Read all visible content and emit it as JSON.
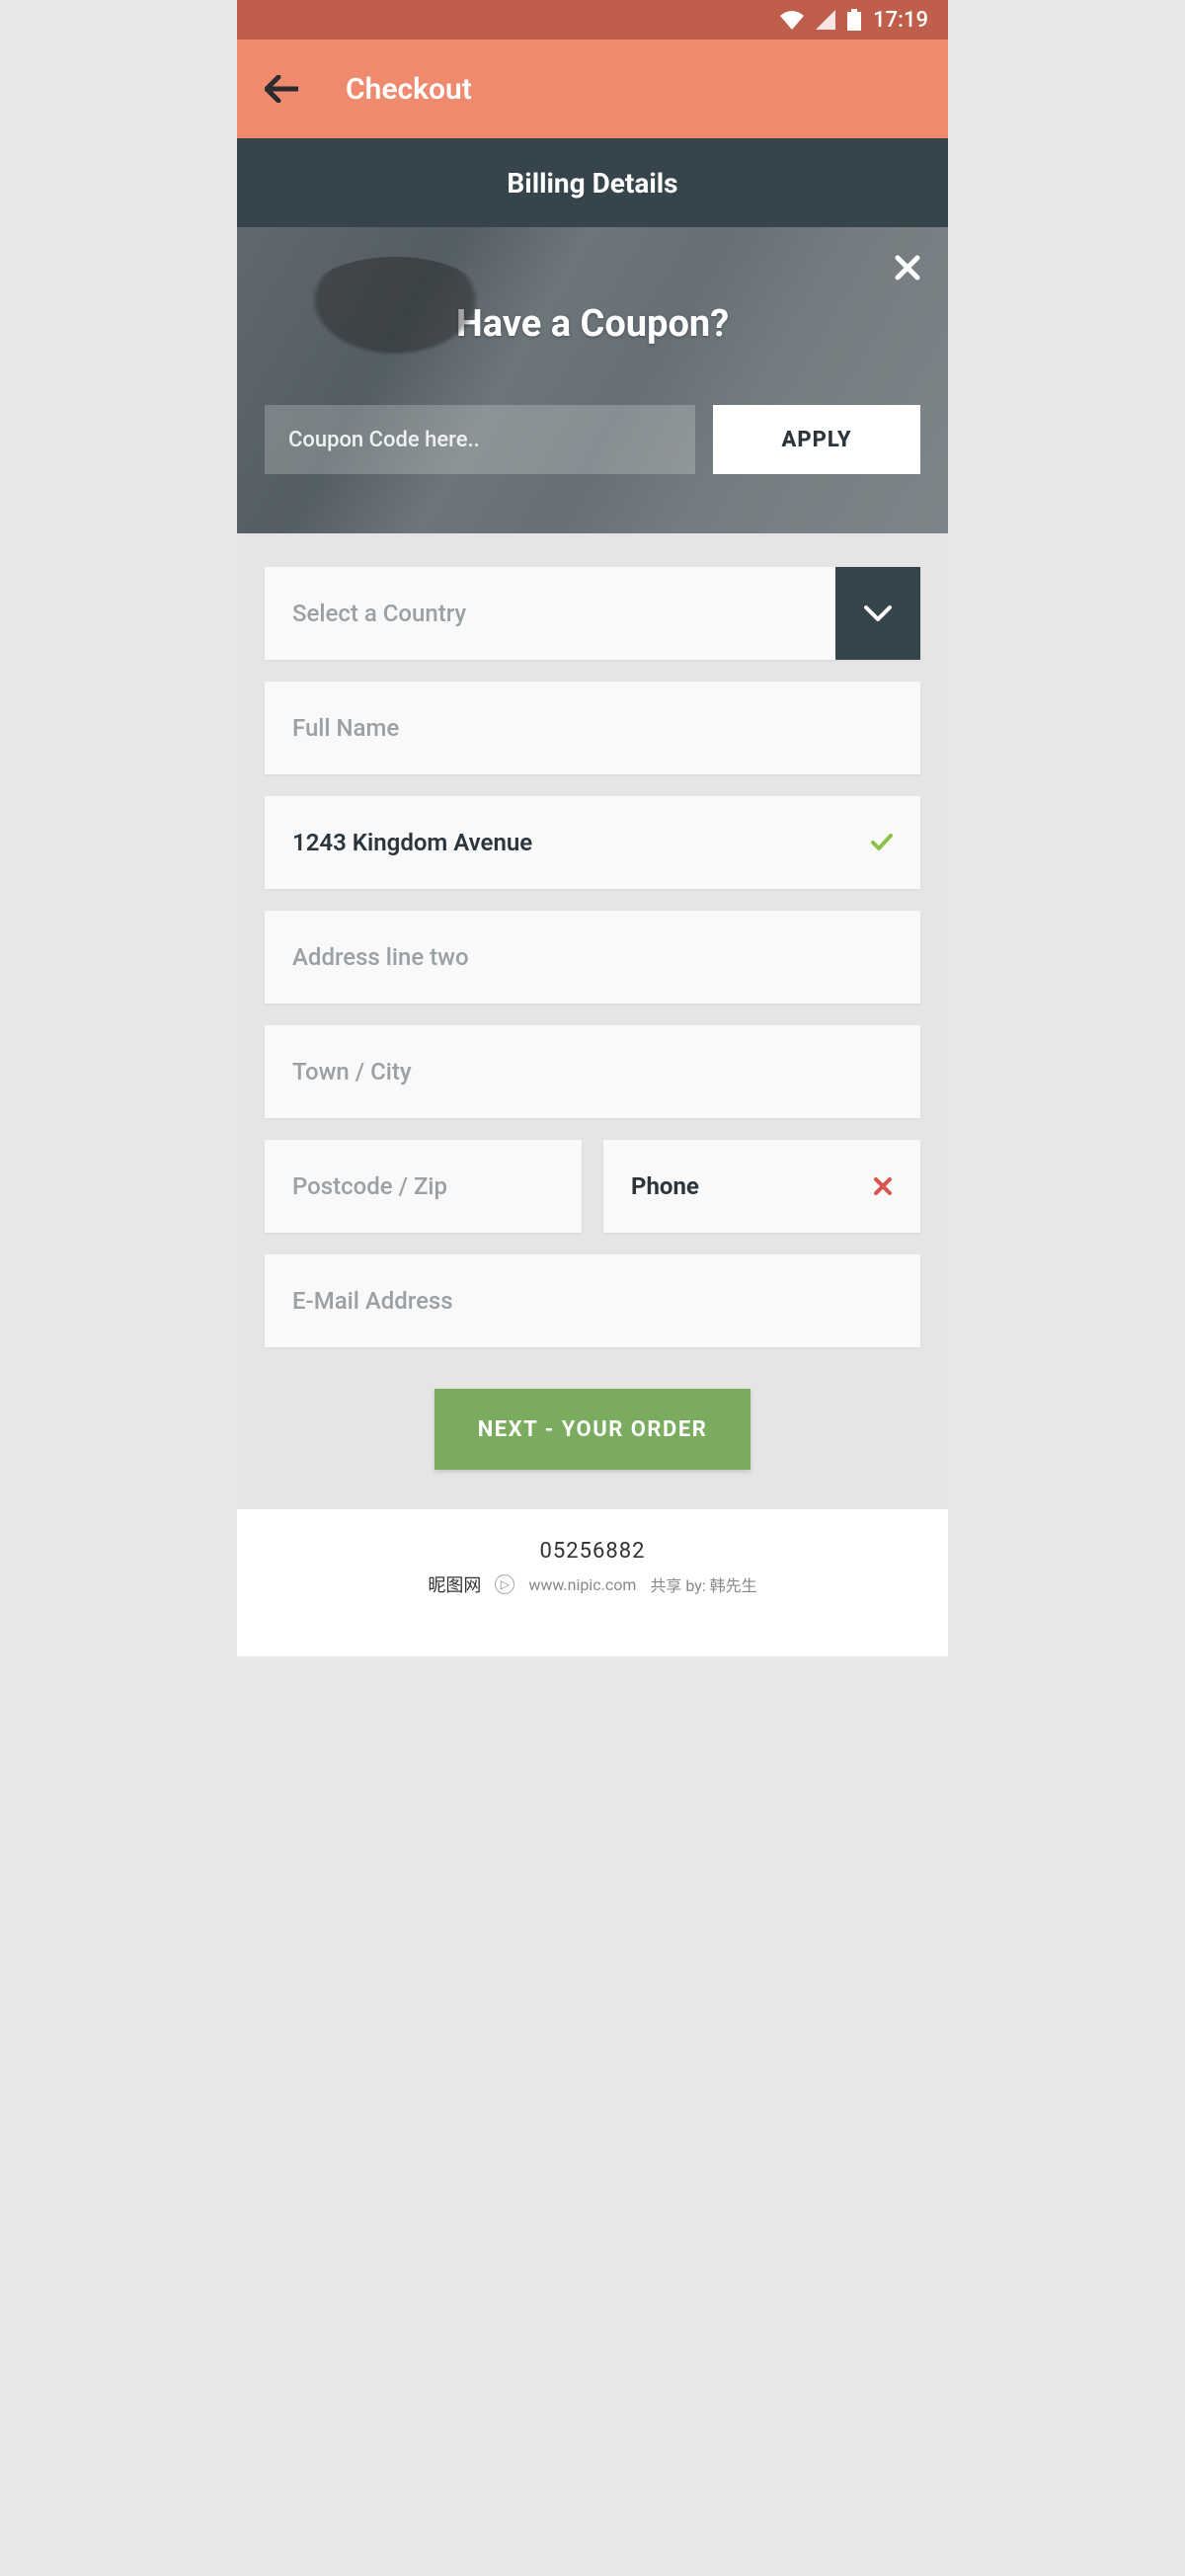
{
  "status": {
    "time": "17:19"
  },
  "appbar": {
    "title": "Checkout"
  },
  "section": {
    "title": "Billing Details"
  },
  "coupon": {
    "heading": "Have a Coupon?",
    "placeholder": "Coupon Code here..",
    "apply": "APPLY"
  },
  "form": {
    "country_placeholder": "Select a Country",
    "fullname_placeholder": "Full Name",
    "address1_value": "1243 Kingdom Avenue",
    "address2_placeholder": "Address line two",
    "city_placeholder": "Town / City",
    "postcode_placeholder": "Postcode / Zip",
    "phone_value": "Phone",
    "email_placeholder": "E-Mail Address"
  },
  "cta": {
    "next": "NEXT  -  YOUR ORDER"
  },
  "footer": {
    "id": "05256882",
    "cn": "昵图网",
    "en": "www.nipic.com",
    "by": "共享 by: 韩先生"
  },
  "colors": {
    "statusbar": "#bf5e4a",
    "appbar": "#ef8a6f",
    "dark": "#36444c",
    "green": "#7aab5e",
    "error": "#d9534f",
    "ok": "#8bc34a"
  }
}
